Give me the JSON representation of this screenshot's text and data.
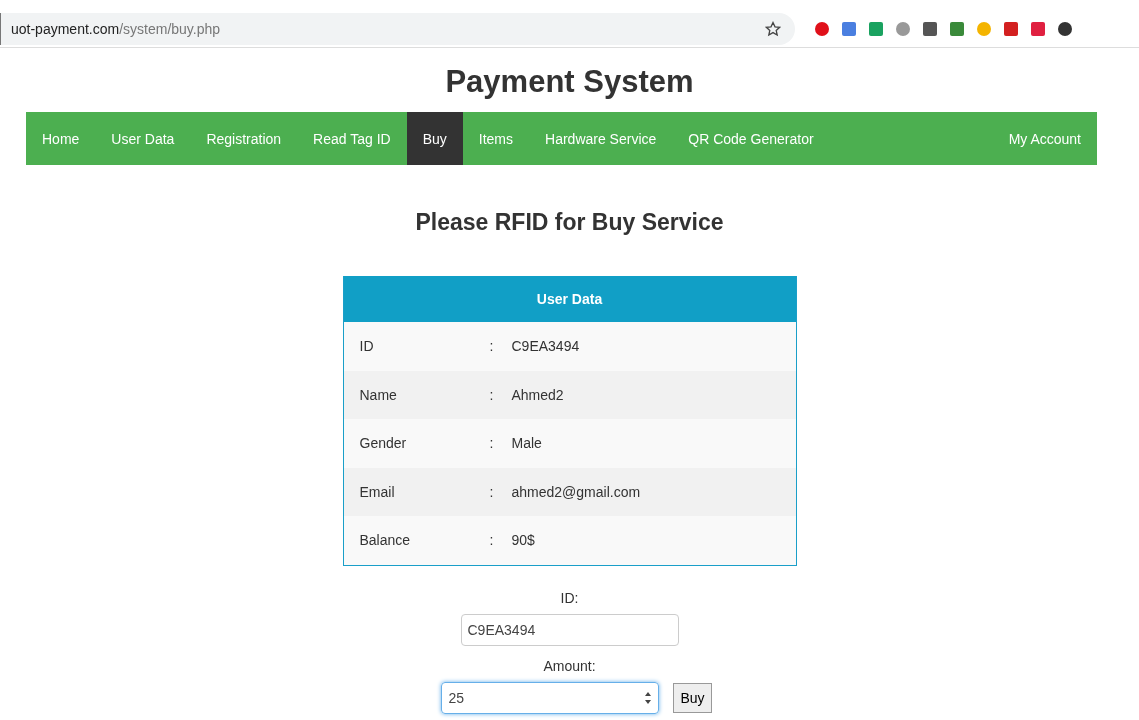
{
  "browser": {
    "url_host": "uot-payment.com",
    "url_path": "/system/buy.php"
  },
  "title": "Payment System",
  "nav": {
    "items": [
      {
        "label": "Home",
        "selected": false
      },
      {
        "label": "User Data",
        "selected": false
      },
      {
        "label": "Registration",
        "selected": false
      },
      {
        "label": "Read Tag ID",
        "selected": false
      },
      {
        "label": "Buy",
        "selected": true
      },
      {
        "label": "Items",
        "selected": false
      },
      {
        "label": "Hardware Service",
        "selected": false
      },
      {
        "label": "QR Code Generator",
        "selected": false
      }
    ],
    "account": "My Account"
  },
  "heading": "Please RFID for Buy Service",
  "user_table": {
    "title": "User Data",
    "rows": [
      {
        "label": "ID",
        "separator": ":",
        "value": "C9EA3494"
      },
      {
        "label": "Name",
        "separator": ":",
        "value": "Ahmed2"
      },
      {
        "label": "Gender",
        "separator": ":",
        "value": "Male"
      },
      {
        "label": "Email",
        "separator": ":",
        "value": "ahmed2@gmail.com"
      },
      {
        "label": "Balance",
        "separator": ":",
        "value": "90$"
      }
    ]
  },
  "form": {
    "id_label": "ID:",
    "id_value": "C9EA3494",
    "amount_label": "Amount:",
    "amount_value": "25",
    "amount_focused": true,
    "submit": "Buy"
  }
}
